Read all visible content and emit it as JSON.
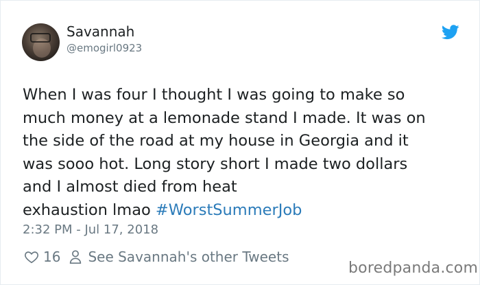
{
  "user": {
    "name": "Savannah",
    "handle": "@emogirl0923"
  },
  "tweet": {
    "text": "When I was four I thought I was going to make so\nmuch money at a lemonade stand I made. It was on\nthe side of the road at my house in Georgia and it\nwas sooo hot. Long story short I made two dollars\nand I almost died from heat\nexhaustion lmao  ",
    "hashtag": "#WorstSummerJob",
    "timestamp": "2:32 PM - Jul 17, 2018"
  },
  "actions": {
    "like_count": "16",
    "profile_link": "See Savannah's other Tweets"
  },
  "watermark": "boredpanda.com",
  "colors": {
    "brand_blue": "#1da1f2",
    "hashtag_blue": "#2b7bb9",
    "muted": "#697882",
    "text": "#1c2022"
  },
  "icons": [
    "twitter-bird-icon",
    "heart-icon",
    "person-icon"
  ]
}
